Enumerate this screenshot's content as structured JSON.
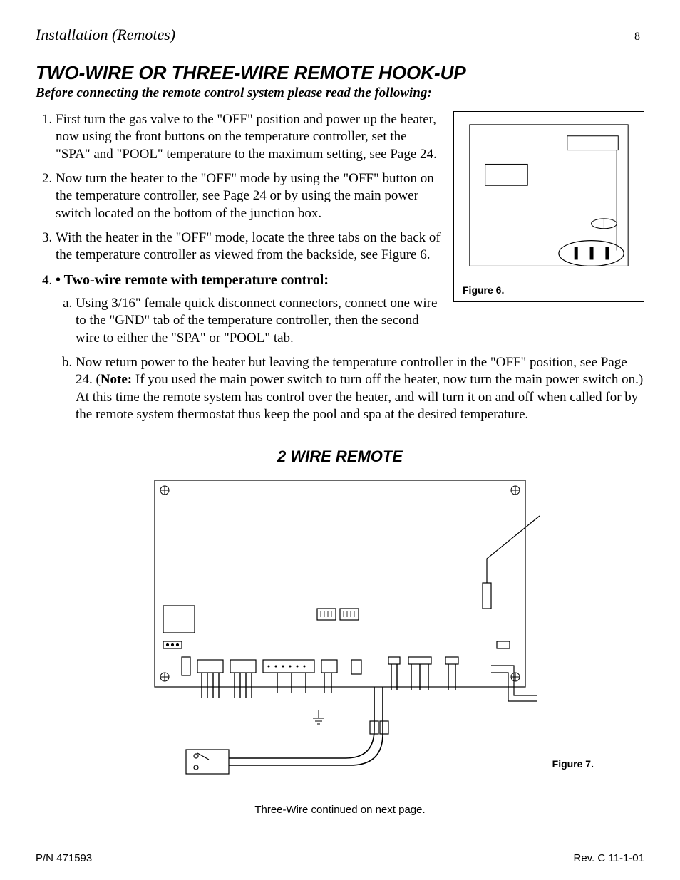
{
  "header": {
    "section": "Installation (Remotes)",
    "page_no": "8"
  },
  "title": "TWO-WIRE OR THREE-WIRE REMOTE HOOK-UP",
  "intro": "Before connecting the remote control system please read the following:",
  "list": {
    "item1": "First turn the gas valve to the \"OFF\" position and power up the heater, now using the front buttons on the temperature controller, set the \"SPA\" and \"POOL\" temperature to the maximum setting, see Page 24.",
    "item2": "Now turn the heater to the \"OFF\" mode by using the \"OFF\" button on the temperature controller, see Page 24 or by using the main power switch located on the bottom of the junction box.",
    "item3": "With the heater in the \"OFF\" mode, locate the three tabs on the back of the temperature controller as viewed from the backside, see Figure 6.",
    "item4_bullet": "• Two-wire remote with temperature control:",
    "item4a": "Using 3/16\" female quick disconnect connectors, connect one wire to the \"GND\" tab of the temperature controller, then the second wire to either the \"SPA\" or  \"POOL\" tab.",
    "item4b_pre": "Now return power to the heater but leaving the temperature controller in the \"OFF\" position, see Page 24. (",
    "item4b_note": "Note:",
    "item4b_post": " If you used the main power switch to turn off the heater, now turn the main power switch on.) At this time the remote system has control over the heater, and will turn it on and off when called for by the remote system thermostat thus keep the pool and spa at the desired temperature."
  },
  "figures": {
    "fig6_label": "Figure 6.",
    "fig7_title": "2 WIRE REMOTE",
    "fig7_label": "Figure 7."
  },
  "continuation": "Three-Wire continued on next page.",
  "footer": {
    "pn": "P/N 471593",
    "rev": "Rev. C  11-1-01"
  }
}
